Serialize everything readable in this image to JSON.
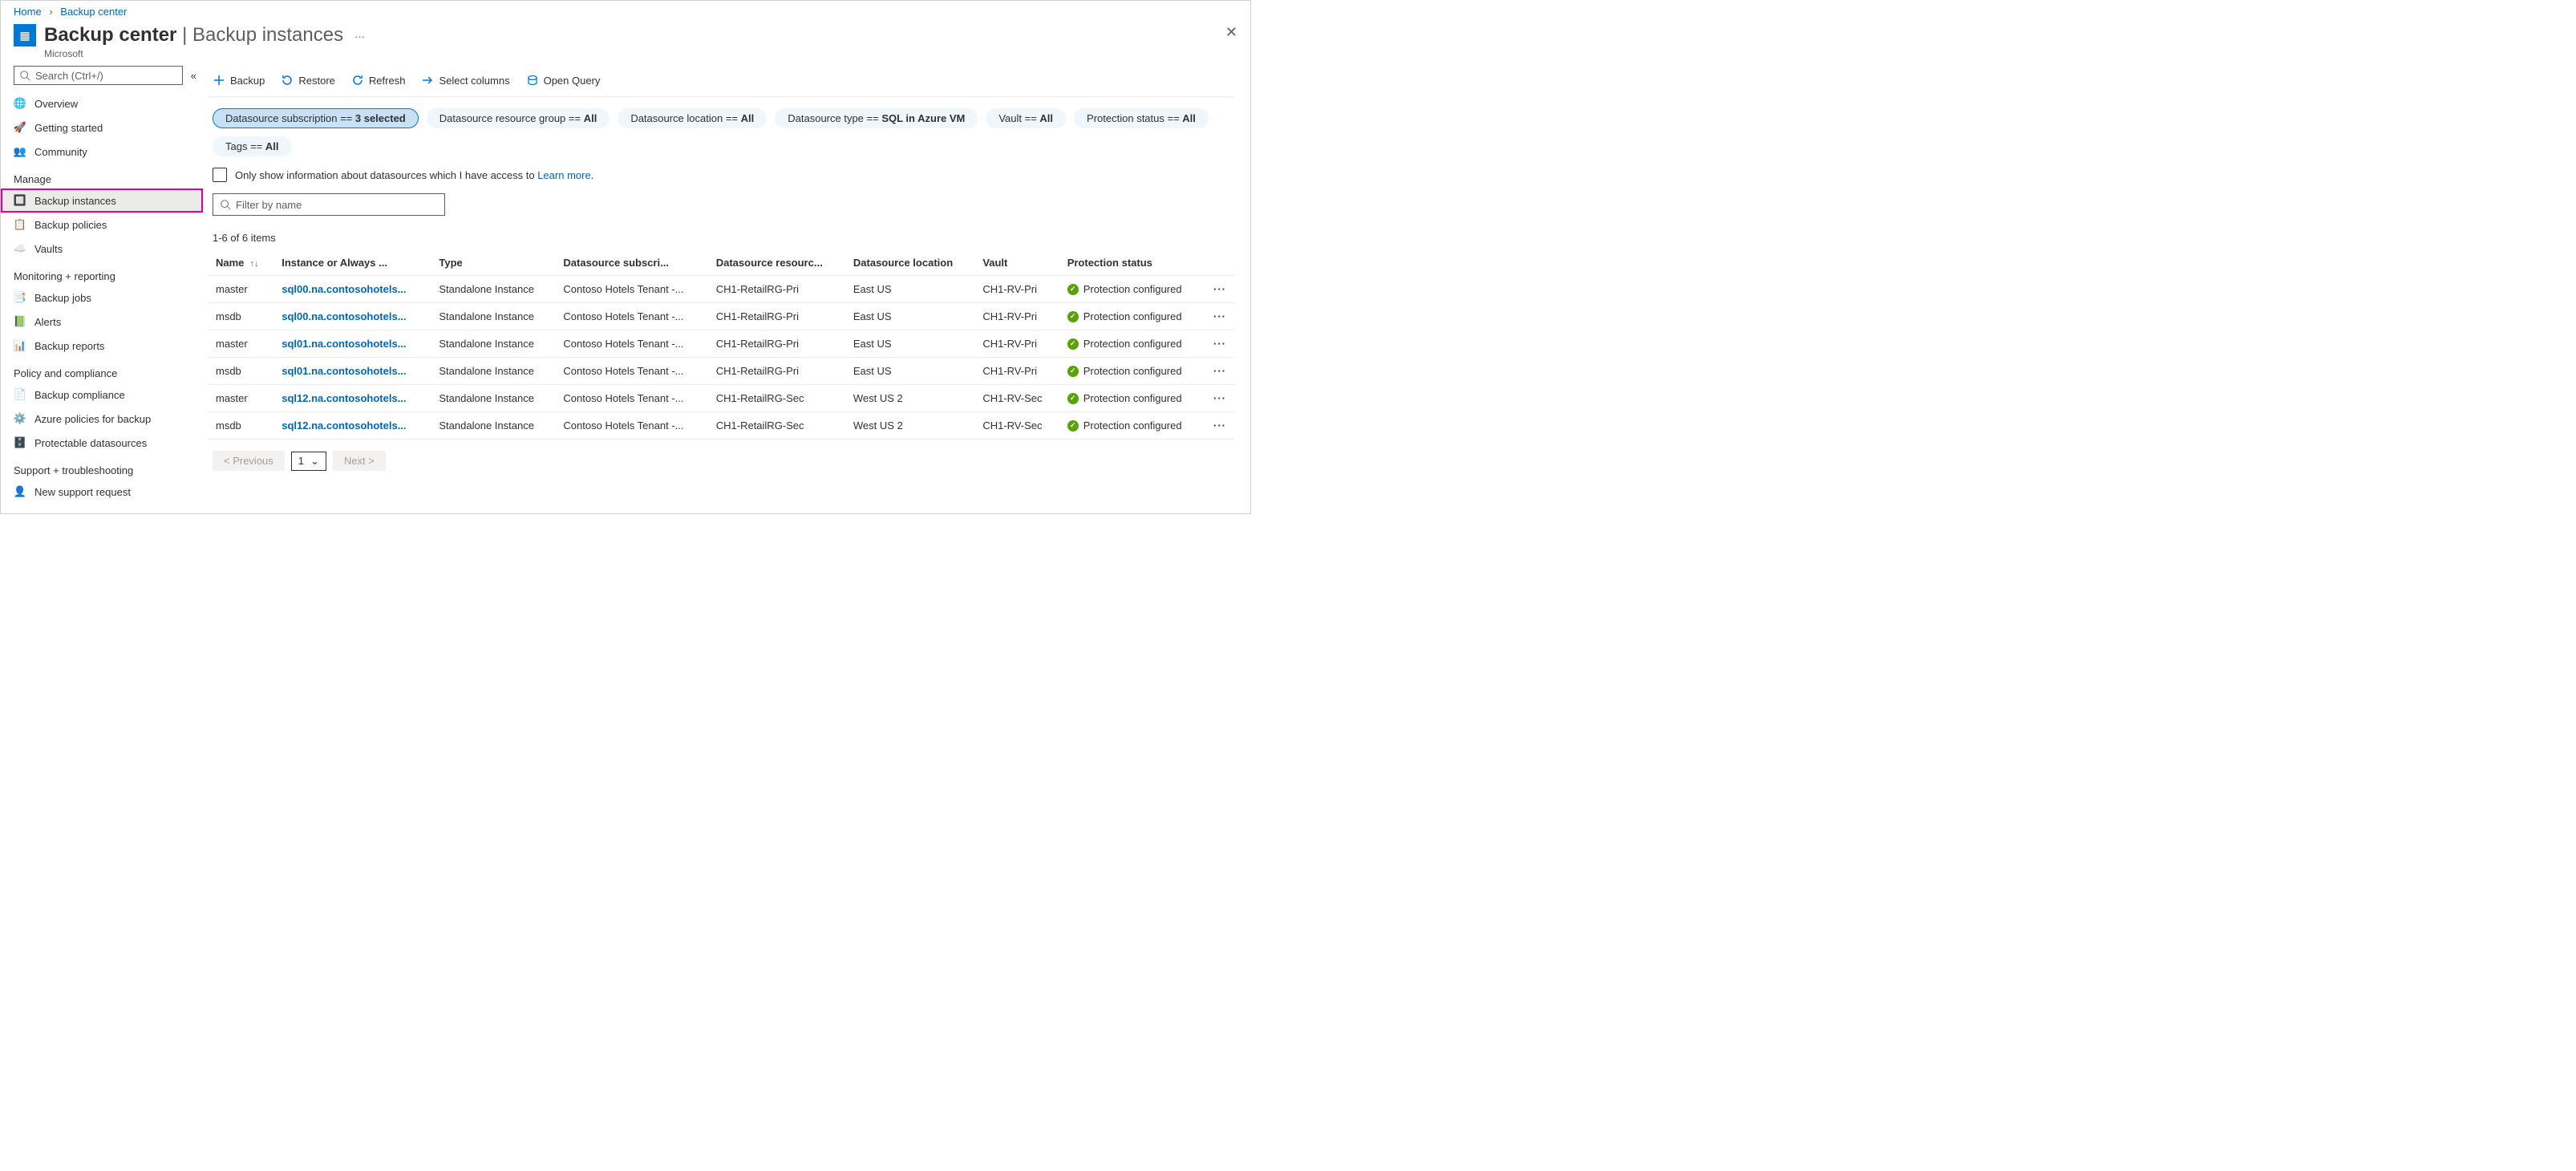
{
  "breadcrumb": {
    "home": "Home",
    "current": "Backup center"
  },
  "header": {
    "title_primary": "Backup center",
    "title_secondary": "Backup instances",
    "subtitle": "Microsoft"
  },
  "sidebar": {
    "search_placeholder": "Search (Ctrl+/)",
    "items_top": [
      {
        "icon": "🌐",
        "label": "Overview"
      },
      {
        "icon": "🚀",
        "label": "Getting started"
      },
      {
        "icon": "👥",
        "label": "Community"
      }
    ],
    "groups": [
      {
        "label": "Manage",
        "items": [
          {
            "icon": "🔲",
            "label": "Backup instances",
            "selected": true,
            "highlighted": true
          },
          {
            "icon": "📋",
            "label": "Backup policies"
          },
          {
            "icon": "☁️",
            "label": "Vaults"
          }
        ]
      },
      {
        "label": "Monitoring + reporting",
        "items": [
          {
            "icon": "📑",
            "label": "Backup jobs"
          },
          {
            "icon": "📗",
            "label": "Alerts"
          },
          {
            "icon": "📊",
            "label": "Backup reports"
          }
        ]
      },
      {
        "label": "Policy and compliance",
        "items": [
          {
            "icon": "📄",
            "label": "Backup compliance"
          },
          {
            "icon": "⚙️",
            "label": "Azure policies for backup"
          },
          {
            "icon": "🗄️",
            "label": "Protectable datasources"
          }
        ]
      },
      {
        "label": "Support + troubleshooting",
        "items": [
          {
            "icon": "👤",
            "label": "New support request"
          }
        ]
      }
    ]
  },
  "toolbar": {
    "backup": "Backup",
    "restore": "Restore",
    "refresh": "Refresh",
    "select_columns": "Select columns",
    "open_query": "Open Query"
  },
  "pills": [
    {
      "text_pre": "Datasource subscription == ",
      "value": "3 selected",
      "active": true
    },
    {
      "text_pre": "Datasource resource group == ",
      "value": "All"
    },
    {
      "text_pre": "Datasource location == ",
      "value": "All"
    },
    {
      "text_pre": "Datasource type == ",
      "value": "SQL in Azure VM"
    },
    {
      "text_pre": "Vault == ",
      "value": "All"
    },
    {
      "text_pre": "Protection status == ",
      "value": "All"
    },
    {
      "text_pre": "Tags == ",
      "value": "All"
    }
  ],
  "access_checkbox": {
    "label": "Only show information about datasources which I have access to ",
    "link": "Learn more"
  },
  "filter_placeholder": "Filter by name",
  "item_count": "1-6 of 6 items",
  "columns": [
    "Name",
    "Instance or Always ...",
    "Type",
    "Datasource subscri...",
    "Datasource resourc...",
    "Datasource location",
    "Vault",
    "Protection status"
  ],
  "rows": [
    {
      "name": "master",
      "instance": "sql00.na.contosohotels...",
      "type": "Standalone Instance",
      "sub": "Contoso Hotels Tenant -...",
      "rg": "CH1-RetailRG-Pri",
      "loc": "East US",
      "vault": "CH1-RV-Pri",
      "status": "Protection configured"
    },
    {
      "name": "msdb",
      "instance": "sql00.na.contosohotels...",
      "type": "Standalone Instance",
      "sub": "Contoso Hotels Tenant -...",
      "rg": "CH1-RetailRG-Pri",
      "loc": "East US",
      "vault": "CH1-RV-Pri",
      "status": "Protection configured"
    },
    {
      "name": "master",
      "instance": "sql01.na.contosohotels...",
      "type": "Standalone Instance",
      "sub": "Contoso Hotels Tenant -...",
      "rg": "CH1-RetailRG-Pri",
      "loc": "East US",
      "vault": "CH1-RV-Pri",
      "status": "Protection configured"
    },
    {
      "name": "msdb",
      "instance": "sql01.na.contosohotels...",
      "type": "Standalone Instance",
      "sub": "Contoso Hotels Tenant -...",
      "rg": "CH1-RetailRG-Pri",
      "loc": "East US",
      "vault": "CH1-RV-Pri",
      "status": "Protection configured"
    },
    {
      "name": "master",
      "instance": "sql12.na.contosohotels...",
      "type": "Standalone Instance",
      "sub": "Contoso Hotels Tenant -...",
      "rg": "CH1-RetailRG-Sec",
      "loc": "West US 2",
      "vault": "CH1-RV-Sec",
      "status": "Protection configured"
    },
    {
      "name": "msdb",
      "instance": "sql12.na.contosohotels...",
      "type": "Standalone Instance",
      "sub": "Contoso Hotels Tenant -...",
      "rg": "CH1-RetailRG-Sec",
      "loc": "West US 2",
      "vault": "CH1-RV-Sec",
      "status": "Protection configured"
    }
  ],
  "pager": {
    "prev": "< Previous",
    "page": "1",
    "next": "Next >"
  }
}
